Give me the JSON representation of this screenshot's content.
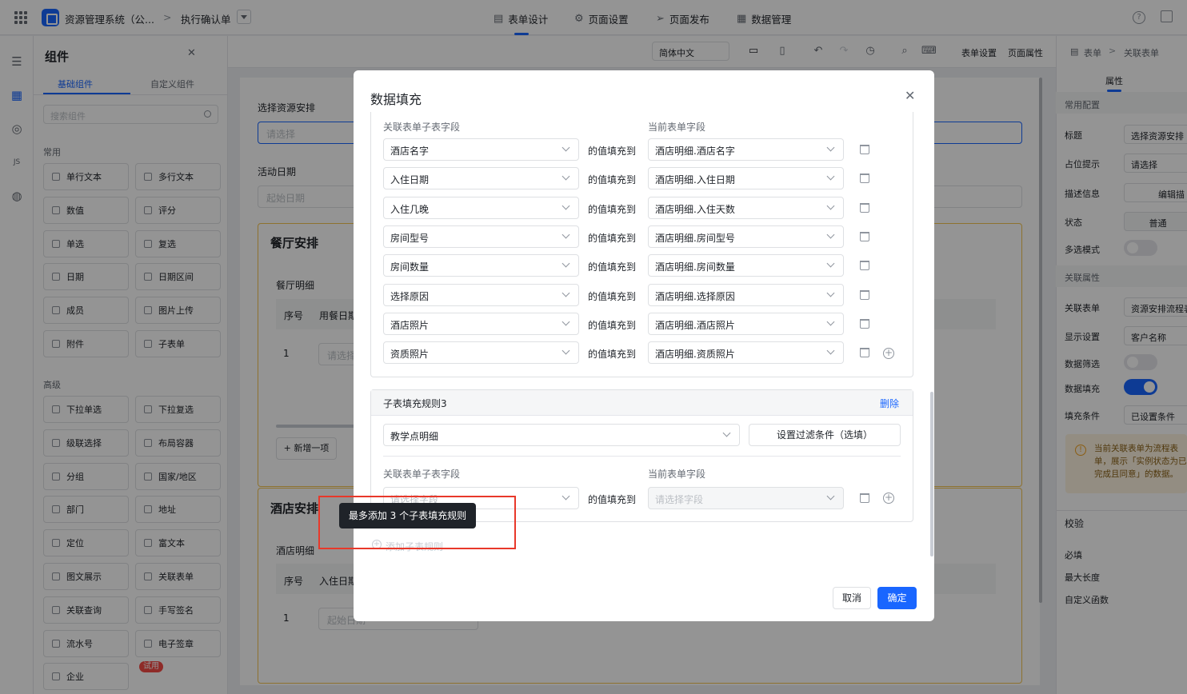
{
  "topbar": {
    "app_name": "资源管理系统（公...",
    "breadcrumb_sep": ">",
    "page_name": "执行确认单",
    "nav": [
      {
        "icon": "document-icon",
        "label": "表单设计",
        "active": true
      },
      {
        "icon": "settings-icon",
        "label": "页面设置",
        "active": false
      },
      {
        "icon": "send-icon",
        "label": "页面发布",
        "active": false
      },
      {
        "icon": "table-icon",
        "label": "数据管理",
        "active": false
      }
    ]
  },
  "components_panel": {
    "title": "组件",
    "tabs": [
      "基础组件",
      "自定义组件"
    ],
    "search_placeholder": "搜索组件",
    "section_common": "常用",
    "section_advanced": "高级",
    "common_items": [
      "单行文本",
      "多行文本",
      "数值",
      "评分",
      "单选",
      "复选",
      "日期",
      "日期区间",
      "成员",
      "图片上传",
      "附件",
      "子表单"
    ],
    "advanced_items": [
      "下拉单选",
      "下拉复选",
      "级联选择",
      "布局容器",
      "分组",
      "国家/地区",
      "部门",
      "地址",
      "定位",
      "富文本",
      "图文展示",
      "关联表单",
      "关联查询",
      "手写签名",
      "流水号",
      "电子签章",
      "企业"
    ],
    "trial_badge": "试用"
  },
  "toolbar": {
    "language": "简体中文",
    "form_settings": "表单设置",
    "page_props": "页面属性"
  },
  "form_canvas": {
    "field1_label": "选择资源安排",
    "field1_placeholder": "请选择",
    "field2_label": "活动日期",
    "field2_placeholder": "起始日期",
    "section1_title": "餐厅安排",
    "section1_sub": "餐厅明细",
    "col_index": "序号",
    "col_meal_date": "用餐日期",
    "row_index": "1",
    "row_placeholder": "请选择",
    "add_row": "+ 新增一项",
    "section2_title": "酒店安排",
    "section2_sub": "酒店明细",
    "col_checkin": "入住日期",
    "row2_placeholder": "起始日期"
  },
  "props_panel": {
    "breadcrumb": [
      "表单",
      "关联表单"
    ],
    "tab": "属性",
    "group_common": "常用配置",
    "rows": [
      {
        "label": "标题",
        "value": "选择资源安排"
      },
      {
        "label": "占位提示",
        "value": "请选择"
      },
      {
        "label": "描述信息",
        "value": "编辑描"
      },
      {
        "label": "状态",
        "value": "普通"
      },
      {
        "label": "多选模式",
        "value": ""
      }
    ],
    "group_assoc": "关联属性",
    "assoc_rows": [
      {
        "label": "关联表单",
        "value": "资源安排流程表"
      },
      {
        "label": "显示设置",
        "value": "客户名称"
      },
      {
        "label": "数据筛选",
        "value": ""
      },
      {
        "label": "数据填充",
        "value": ""
      },
      {
        "label": "填充条件",
        "value": "已设置条件"
      }
    ],
    "notice": "当前关联表单为流程表单，展示「实例状态为已完成且同意」的数据。",
    "group_validate": "校验",
    "validate_items": [
      "必填",
      "最大长度",
      "自定义函数"
    ]
  },
  "modal": {
    "title": "数据填充",
    "col_left": "关联表单子表字段",
    "col_right": "当前表单字段",
    "fill_to": "的值填充到",
    "mappings": [
      {
        "source": "酒店名字",
        "target": "酒店明细.酒店名字"
      },
      {
        "source": "入住日期",
        "target": "酒店明细.入住日期"
      },
      {
        "source": "入住几晚",
        "target": "酒店明细.入住天数"
      },
      {
        "source": "房间型号",
        "target": "酒店明细.房间型号"
      },
      {
        "source": "房间数量",
        "target": "酒店明细.房间数量"
      },
      {
        "source": "选择原因",
        "target": "酒店明细.选择原因"
      },
      {
        "source": "酒店照片",
        "target": "酒店明细.酒店照片"
      },
      {
        "source": "资质照片",
        "target": "酒店明细.资质照片"
      }
    ],
    "rule3_title": "子表填充规则3",
    "rule3_delete": "删除",
    "rule3_subtable": "教学点明细",
    "rule3_filter_btn": "设置过滤条件（选填）",
    "rule3_source_placeholder": "请选择字段",
    "rule3_target_placeholder": "请选择字段",
    "add_rule": "添加子表规则",
    "tooltip": "最多添加 3 个子表填充规则",
    "cancel": "取消",
    "confirm": "确定"
  }
}
